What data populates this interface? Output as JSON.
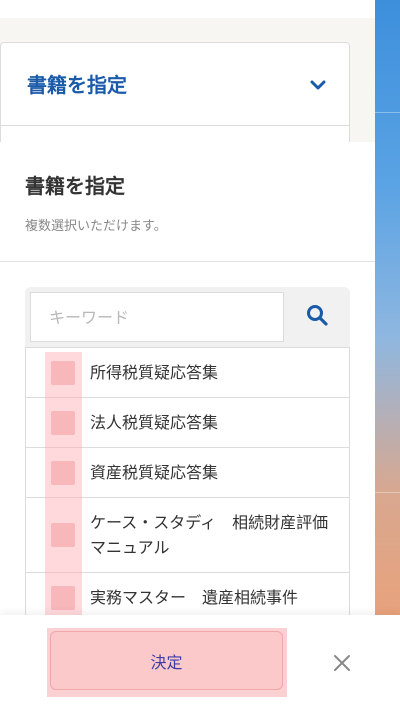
{
  "accordion": {
    "title": "書籍を指定",
    "icon": "chevron-down-icon"
  },
  "panel": {
    "title": "書籍を指定",
    "subtitle": "複数選択いただけます。"
  },
  "search": {
    "placeholder": "キーワード",
    "value": "",
    "icon": "search-icon"
  },
  "books": [
    {
      "label": "所得税質疑応答集",
      "checked": false
    },
    {
      "label": "法人税質疑応答集",
      "checked": false
    },
    {
      "label": "資産税質疑応答集",
      "checked": false
    },
    {
      "label": "ケース・スタディ　相続財産評価マニュアル",
      "checked": false
    },
    {
      "label": "実務マスター　遺産相続事件",
      "checked": false
    }
  ],
  "footer": {
    "submit_label": "決定",
    "close_icon": "close-icon"
  },
  "colors": {
    "brand_blue": "#1a5aa8",
    "highlight": "#fcc9cb",
    "submit_text": "#3c3ca8"
  }
}
